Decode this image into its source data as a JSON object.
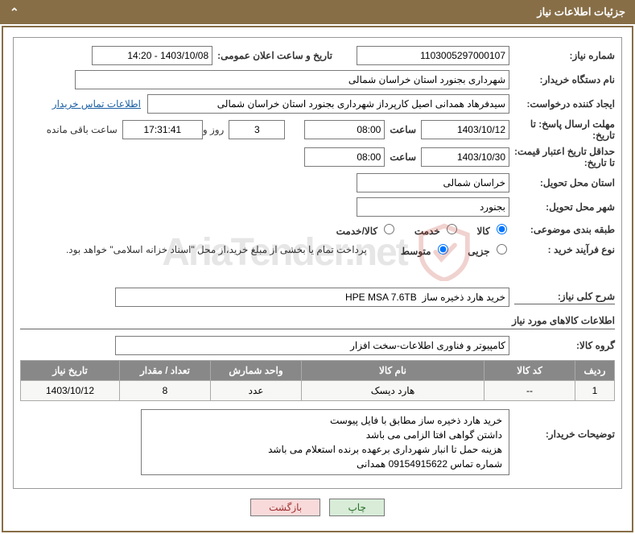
{
  "header": {
    "title": "جزئیات اطلاعات نیاز"
  },
  "fields": {
    "need_no_label": "شماره نیاز:",
    "need_no": "1103005297000107",
    "announce_label": "تاریخ و ساعت اعلان عمومی:",
    "announce": "1403/10/08 - 14:20",
    "buyer_label": "نام دستگاه خریدار:",
    "buyer": "شهرداری بجنورد استان خراسان شمالی",
    "requester_label": "ایجاد کننده درخواست:",
    "requester": "سیدفرهاد همدانی اصیل کارپرداز شهرداری بجنورد استان خراسان شمالی",
    "contact_link": "اطلاعات تماس خریدار",
    "deadline_label": "مهلت ارسال پاسخ: تا تاریخ:",
    "deadline_date": "1403/10/12",
    "hour_label": "ساعت",
    "deadline_hour": "08:00",
    "days_remain": "3",
    "days_word": "روز و",
    "time_remain": "17:31:41",
    "remain_after": "ساعت باقی مانده",
    "validity_label": "حداقل تاریخ اعتبار قیمت: تا تاریخ:",
    "validity_date": "1403/10/30",
    "validity_hour": "08:00",
    "province_label": "استان محل تحویل:",
    "province": "خراسان شمالی",
    "city_label": "شهر محل تحویل:",
    "city": "بجنورد",
    "category_label": "طبقه بندی موضوعی:",
    "cat_goods": "کالا",
    "cat_service": "خدمت",
    "cat_both": "کالا/خدمت",
    "process_label": "نوع فرآیند خرید :",
    "proc_partial": "جزیی",
    "proc_medium": "متوسط",
    "payment_note": "پرداخت تمام یا بخشی از مبلغ خرید،از محل \"اسناد خزانه اسلامی\" خواهد بود.",
    "summary_label": "شرح کلی نیاز:",
    "summary": "خرید هارد ذخیره ساز  HPE MSA 7.6TB",
    "items_section": "اطلاعات کالاهای مورد نیاز",
    "group_label": "گروه کالا:",
    "group": "کامپیوتر و فناوری اطلاعات-سخت افزار"
  },
  "table": {
    "headers": [
      "ردیف",
      "کد کالا",
      "نام کالا",
      "واحد شمارش",
      "تعداد / مقدار",
      "تاریخ نیاز"
    ],
    "rows": [
      {
        "row": "1",
        "code": "--",
        "name": "هارد دیسک",
        "unit": "عدد",
        "qty": "8",
        "needdate": "1403/10/12"
      }
    ]
  },
  "buyer_desc": {
    "label": "توضیحات خریدار:",
    "line1": "خرید هارد ذخیره ساز مطابق با فایل پیوست",
    "line2": "داشتن گواهی افتا الزامی می باشد",
    "line3": "هزینه حمل تا انبار شهرداری برعهده برنده استعلام می باشد",
    "line4": "شماره تماس 09154915622 همدانی"
  },
  "buttons": {
    "print": "چاپ",
    "back": "بازگشت"
  },
  "watermark": "AriaTender.net"
}
